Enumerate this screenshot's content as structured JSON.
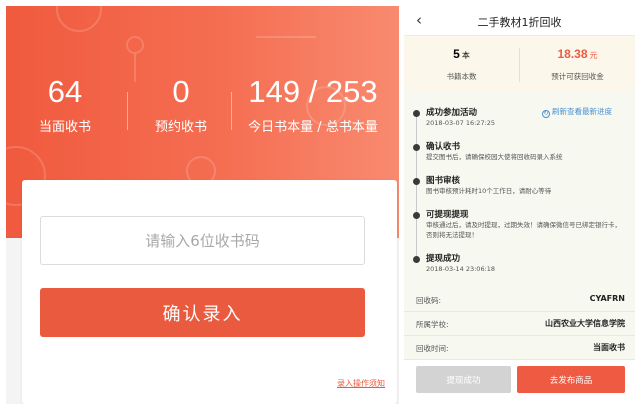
{
  "left": {
    "stats": [
      {
        "value": "64",
        "label": "当面收书"
      },
      {
        "value": "0",
        "label": "预约收书"
      },
      {
        "value": "149 / 253",
        "label": "今日书本量 / 总书本量"
      }
    ],
    "code_input": {
      "placeholder": "请输入6位收书码",
      "value": ""
    },
    "confirm_button": "确认录入",
    "instructions_link": "录入操作须知"
  },
  "right": {
    "nav": {
      "back_icon": "chevron-left-icon",
      "title": "二手教材1折回收"
    },
    "summary": {
      "count_value": "5",
      "count_unit": "本",
      "count_label": "书籍本数",
      "amount_value": "18.38",
      "amount_unit": "元",
      "amount_label": "预计可获回收金",
      "amount_color": "#ef5a43"
    },
    "refresh_link": "刷新查看最新进度",
    "timeline": [
      {
        "title": "成功参加活动",
        "sub": "2018-03-07 16:27:25"
      },
      {
        "title": "确认收书",
        "sub": "提交图书后，请确保校园大使将回收码录入系统"
      },
      {
        "title": "图书审核",
        "sub": "图书审核预计耗时10个工作日，请耐心等待"
      },
      {
        "title": "可提现提现",
        "sub": "审核通过后，请及时提现，过期失效！请确保微信号已绑定银行卡，否则将无法提现！"
      },
      {
        "title": "提现成功",
        "sub": "2018-03-14 23:06:18"
      }
    ],
    "info": [
      {
        "key": "回收码:",
        "value": "CYAFRN"
      },
      {
        "key": "所属学校:",
        "value": "山西农业大学信息学院"
      },
      {
        "key": "回收时间:",
        "value": "当面收书"
      }
    ],
    "buttons": {
      "withdraw": "提现成功",
      "publish": "去发布商品"
    }
  },
  "colors": {
    "accent": "#ef5a43",
    "banner": "#f05a3e",
    "link": "#4a8fd0"
  }
}
